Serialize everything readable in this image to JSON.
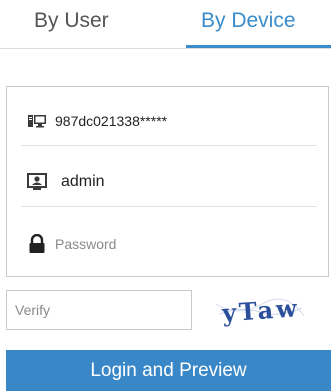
{
  "tabs": {
    "user_label": "By User",
    "device_label": "By Device",
    "active": "By Device"
  },
  "form": {
    "device_serial": "987dc021338*****",
    "username": "admin",
    "password_placeholder": "Password",
    "verify_placeholder": "Verify",
    "captcha_text": "yTaw",
    "login_button": "Login and Preview"
  },
  "icons": {
    "device": "device-icon",
    "user": "user-icon",
    "password": "lock-icon"
  },
  "colors": {
    "accent": "#3a8ccb",
    "button": "#3a87c8",
    "captcha_text": "#2b4f9a"
  }
}
